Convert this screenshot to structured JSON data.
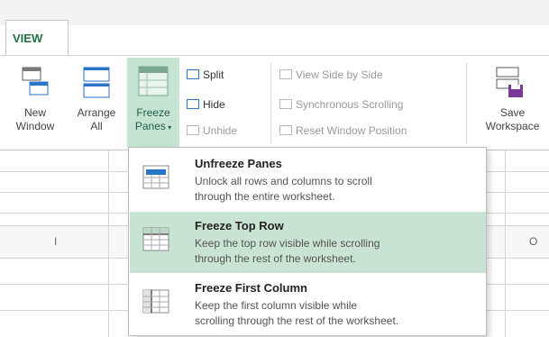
{
  "tab": {
    "label": "VIEW"
  },
  "ribbon": {
    "new_window": {
      "line1": "New",
      "line2": "Window"
    },
    "arrange_all": {
      "line1": "Arrange",
      "line2": "All"
    },
    "freeze_panes": {
      "line1": "Freeze",
      "line2": "Panes"
    },
    "split": "Split",
    "hide": "Hide",
    "unhide": "Unhide",
    "view_side_by_side": "View Side by Side",
    "synchronous_scrolling": "Synchronous Scrolling",
    "reset_window_position": "Reset Window Position",
    "save_workspace": {
      "line1": "Save",
      "line2": "Workspace"
    }
  },
  "sheet": {
    "col_left": "I",
    "col_right": "O"
  },
  "menu": {
    "items": [
      {
        "title": "Unfreeze Panes",
        "desc_line1": "Unlock all rows and columns to scroll",
        "desc_line2": "through the entire worksheet."
      },
      {
        "title": "Freeze Top Row",
        "desc_line1": "Keep the top row visible while scrolling",
        "desc_line2": "through the rest of the worksheet."
      },
      {
        "title": "Freeze First Column",
        "desc_line1": "Keep the first column visible while",
        "desc_line2": "scrolling through the rest of the worksheet."
      }
    ]
  },
  "colors": {
    "accent": "#217346",
    "highlight": "#c9e4d3",
    "icon_blue": "#2a75c7"
  }
}
